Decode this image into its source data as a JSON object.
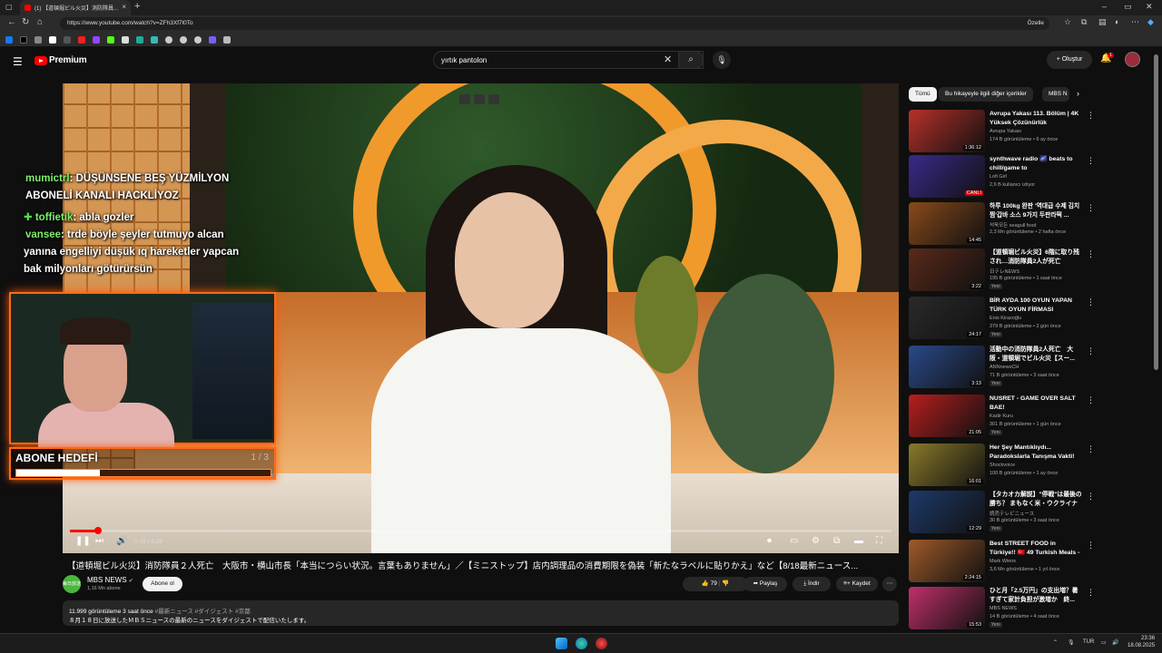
{
  "browser": {
    "tab_title": "(1) 【道頓堀ビル火災】消防隊員...",
    "address": "https://www.youtube.com/watch?v=ZFh3Xf7l0To",
    "customize_label": "Özelle"
  },
  "header": {
    "brand": "Premium",
    "search_value": "yırtık pantolon",
    "create_label": "Oluştur",
    "notification_count": "1"
  },
  "stream_overlay": {
    "chat": [
      {
        "user": "mumictrl",
        "text": ": DÜŞÜNSENE BEŞ YÜZMİLYON"
      },
      {
        "user": "",
        "text": "ABONELİ KANALI HACKLİYOZ"
      },
      {
        "user": "toffietik",
        "text": ": abla gozler"
      },
      {
        "user": "vansee",
        "text": ": trde böyle şeyler tutmuyo alcan"
      },
      {
        "user": "",
        "text": "yanına engelliyi düşük ıq hareketler yapcan"
      },
      {
        "user": "",
        "text": "bak milyonları götürürsün"
      }
    ],
    "goal_title": "ABONE HEDEFİ",
    "goal_count": "1 / 3",
    "goal_fraction": 0.33
  },
  "player": {
    "time": "0:19 / 9:28",
    "progress_fraction": 0.034
  },
  "video": {
    "title": "【道頓堀ビル火災】消防隊員２人死亡　大阪市・横山市長「本当につらい状況。言葉もありません」／【ミニストップ】店内調理品の消費期限を偽装「新たなラベルに貼りかえ」など【8/18最新ニュース...",
    "channel": "MBS NEWS",
    "channel_avatar_text": "毎日放送",
    "subscribers": "1,16 Mn abone",
    "subscribe_label": "Abone ol",
    "likes": "79",
    "share_label": "Paylaş",
    "download_label": "İndir",
    "save_label": "Kaydet",
    "views_line": "11.999 görüntüleme  3 saat önce",
    "tags": "#最新ニュース #ダイジェスト #京都",
    "description": "８月１８日に放送したＭＢＳニュースの最新のニュースをダイジェストで配信いたします。"
  },
  "sidebar": {
    "chips": [
      "Tümü",
      "Bu hikayeyle ilgili diğer içerikler",
      "MBS N"
    ],
    "items": [
      {
        "title": "Avrupa Yakası 113. Bölüm | 4K Yüksek Çözünürlük",
        "channel": "Avrupa Yakası",
        "meta": "174 B görüntüleme • 6 ay önce",
        "duration": "1:36:12",
        "badge": "",
        "color": "#b8302a"
      },
      {
        "title": "synthwave radio 🌌 beats to chill/game to",
        "channel": "Lofi Girl",
        "meta": "2,6 B kullanıcı izliyor",
        "duration": "CANLI",
        "badge": "",
        "color": "#3a2a8a"
      },
      {
        "title": "하루 100kg 완판 '역대급 수제 김치찜'갑바 소스 9가지 두판라떡 ...",
        "channel": "석욱모든 seagull food",
        "meta": "2,3 Mn görüntüleme • 2 hafta önce",
        "duration": "14:45",
        "badge": "",
        "color": "#8a4a1a"
      },
      {
        "title": "【道頓堀ビル火災】6階に取り残され…消防隊員2人が死亡",
        "channel": "日テレNEWS",
        "meta": "195 B görüntüleme • 1 saat önce",
        "duration": "3:22",
        "badge": "Yeni",
        "color": "#5a2a1a"
      },
      {
        "title": "BİR AYDA 100 OYUN YAPAN TÜRK OYUN FİRMASI BULDUM!",
        "channel": "Enis Kirazoğlu",
        "meta": "379 B görüntüleme • 2 gün önce",
        "duration": "24:17",
        "badge": "Yeni",
        "color": "#2a2a2a"
      },
      {
        "title": "活動中の消防隊員2人死亡　大阪・道頓堀でビル火災【スー...",
        "channel": "ANNnewsCH",
        "meta": "71 B görüntüleme • 3 saat önce",
        "duration": "3:13",
        "badge": "Yeni",
        "color": "#2a4a8a"
      },
      {
        "title": "NUSRET - GAME OVER SALT BAE!",
        "channel": "Kadir Kuru",
        "meta": "301 B görüntüleme • 1 gün önce",
        "duration": "21:05",
        "badge": "Yeni",
        "color": "#b81e1e"
      },
      {
        "title": "Her Şey Mantıklıydı... Paradokslarla Tanışma Vakti!",
        "channel": "Shockvoice",
        "meta": "100 B görüntüleme • 1 ay önce",
        "duration": "16:01",
        "badge": "",
        "color": "#8a7a2a"
      },
      {
        "title": "【タカオカ解説】\"停戦\"は最後の勝ち？ まもなく米・ウクライナ会...",
        "channel": "読売テレビニュース",
        "meta": "30 B görüntüleme • 3 saat önce",
        "duration": "12:29",
        "badge": "Yeni",
        "color": "#1e3a6a"
      },
      {
        "title": "Best STREET FOOD in Türkiye!! 🇹🇷 49 Turkish Meals - Istanbul ...",
        "channel": "Mark Wiens",
        "meta": "3,6 Mn görüntüleme • 1 yıl önce",
        "duration": "2:24:15",
        "badge": "",
        "color": "#a05a2a"
      },
      {
        "title": "ひと月「2.5万円」の支出増？暑すぎて家計負担が激増か　終...",
        "channel": "MBS NEWS",
        "meta": "14 B görüntüleme • 4 saat önce",
        "duration": "15:53",
        "badge": "Yeni",
        "color": "#c0306a"
      }
    ]
  },
  "taskbar": {
    "lang": "TUR",
    "time": "23:36",
    "date": "18.08.2025"
  }
}
